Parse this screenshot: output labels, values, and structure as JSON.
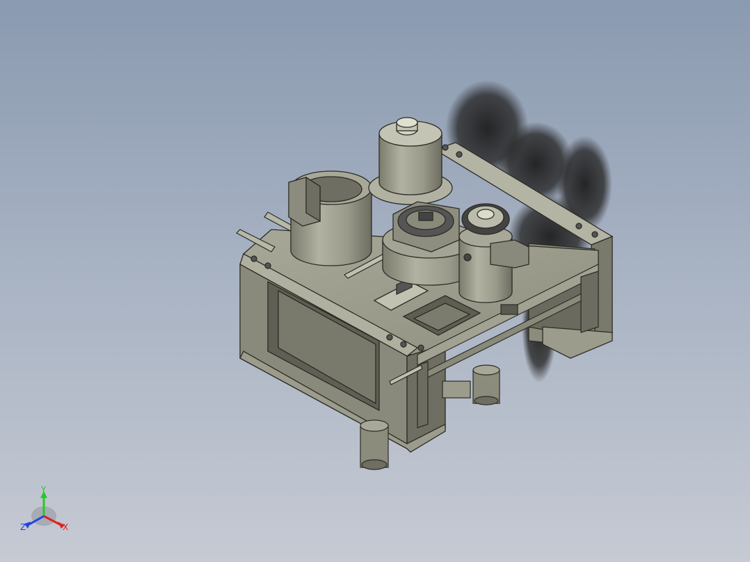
{
  "viewport": {
    "background_top": "#8a9ab0",
    "background_bottom": "#c6cad3",
    "model_color": "#9a9a8a",
    "shadow_color": "#2b2b2b"
  },
  "triad": {
    "y_label": "Y",
    "x_label": "X",
    "z_label": "Z",
    "y_color": "#22cc22",
    "x_color": "#dd2222",
    "z_color": "#2244dd"
  }
}
